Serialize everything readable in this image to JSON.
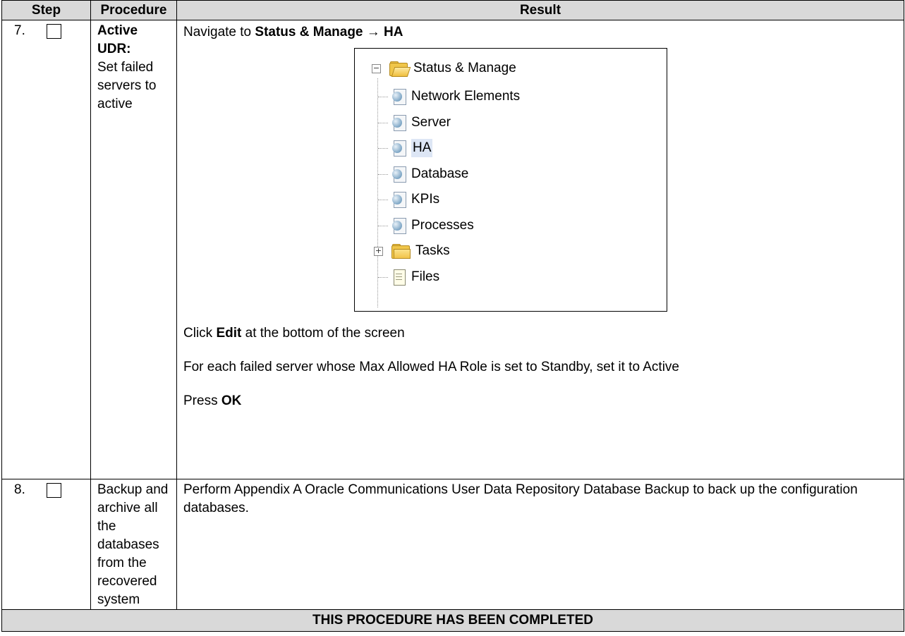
{
  "headers": {
    "step": "Step",
    "procedure": "Procedure",
    "result": "Result"
  },
  "step7": {
    "number": "7.",
    "procedure_bold": "Active UDR:",
    "procedure_text": "Set failed servers to active",
    "nav_prefix": "Navigate to ",
    "nav_bold": "Status & Manage → HA",
    "tree": {
      "root": "Status & Manage",
      "items": [
        "Network Elements",
        "Server",
        "HA",
        "Database",
        "KPIs",
        "Processes"
      ],
      "tasks": "Tasks",
      "files": "Files",
      "root_toggle": "−",
      "tasks_toggle": "+"
    },
    "click_prefix": "Click ",
    "click_bold": "Edit",
    "click_suffix": " at the bottom of the screen",
    "each_text": "For each failed server whose Max Allowed HA Role is set to Standby, set it to Active",
    "press_prefix": "Press ",
    "press_bold": "OK"
  },
  "step8": {
    "number": "8.",
    "procedure_text": "Backup and archive all the databases from the recovered system",
    "result_text": "Perform Appendix A Oracle Communications User Data Repository Database Backup to back up the configuration databases."
  },
  "footer": "THIS PROCEDURE HAS BEEN COMPLETED"
}
